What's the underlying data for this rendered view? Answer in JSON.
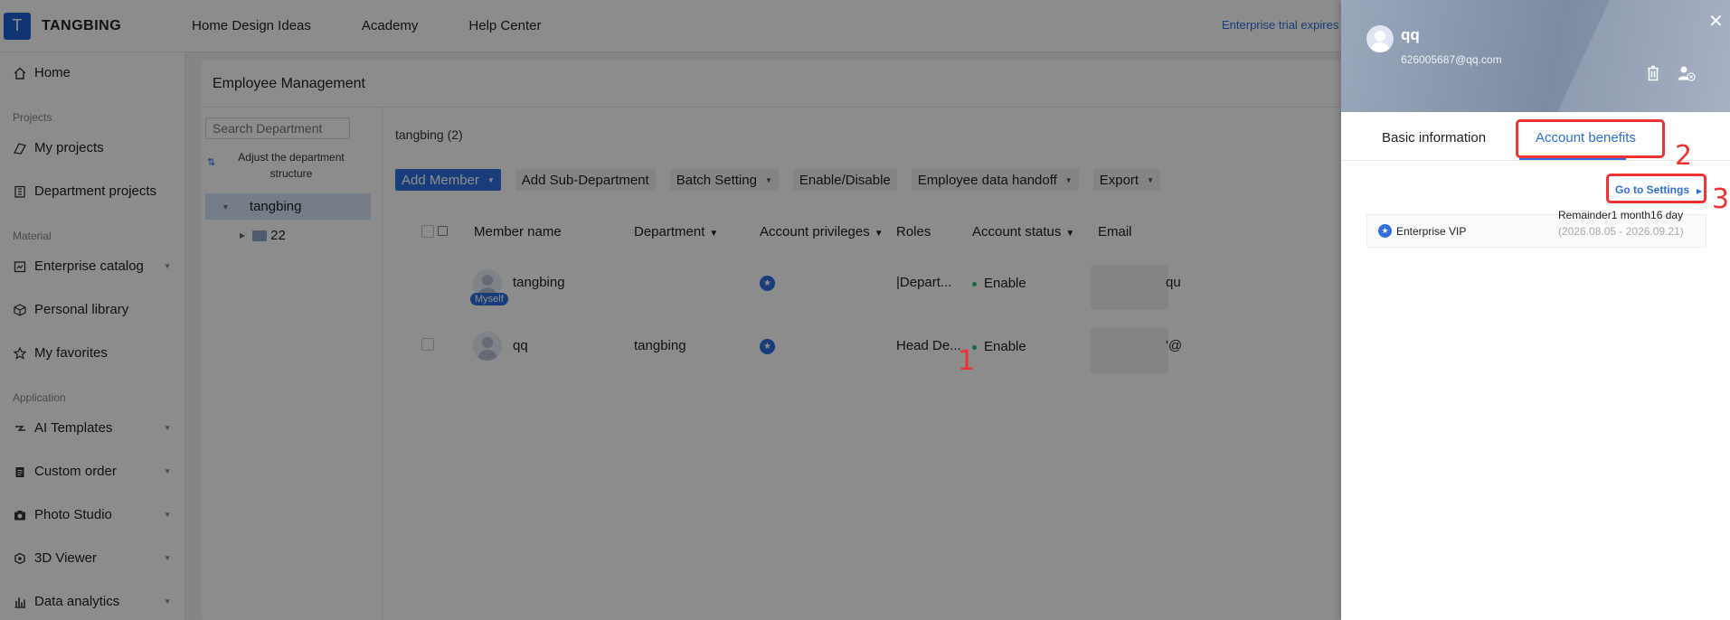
{
  "app": {
    "logo_letter": "T",
    "brand": "TANGBING"
  },
  "topnav": [
    "Home Design Ideas",
    "Academy",
    "Help Center"
  ],
  "trial_text": "Enterprise trial expires i",
  "sidebar": {
    "home": "Home",
    "sec_projects": "Projects",
    "my_projects": "My projects",
    "dept_projects": "Department projects",
    "sec_material": "Material",
    "enterprise_catalog": "Enterprise catalog",
    "personal_library": "Personal library",
    "my_favorites": "My favorites",
    "sec_application": "Application",
    "ai_templates": "AI Templates",
    "custom_order": "Custom order",
    "photo_studio": "Photo Studio",
    "viewer_3d": "3D Viewer",
    "data_analytics": "Data analytics"
  },
  "page": {
    "title": "Employee Management",
    "search_placeholder": "Search Department",
    "adjust_structure": "Adjust the department structure",
    "tree_root": "tangbing",
    "tree_child": "22",
    "member_count": "tangbing (2)"
  },
  "toolbar": {
    "add_member": "Add Member",
    "add_sub_dept": "Add Sub-Department",
    "batch_setting": "Batch Setting",
    "enable_disable": "Enable/Disable",
    "data_handoff": "Employee data handoff",
    "export": "Export"
  },
  "table": {
    "headers": {
      "member_name": "Member name",
      "department": "Department",
      "account_privileges": "Account privileges",
      "roles": "Roles",
      "account_status": "Account status",
      "email": "Email"
    },
    "rows": [
      {
        "name": "tangbing",
        "badge": "Myself",
        "department": "",
        "roles": "|Depart...",
        "status": "Enable",
        "email_partial": "qu"
      },
      {
        "name": "qq",
        "badge": "",
        "department": "tangbing",
        "roles": "Head De...",
        "status": "Enable",
        "email_partial": "'@"
      }
    ]
  },
  "drawer": {
    "name": "qq",
    "email": "626005687@qq.com",
    "tabs": [
      "Basic information",
      "Account benefits"
    ],
    "active_tab": 1,
    "go_to_settings": "Go to Settings",
    "benefit_name": "Enterprise VIP",
    "remainder": "Remainder1 month16 day",
    "date_range": "(2026.08.05 - 2026.09.21)"
  },
  "annotations": [
    "1",
    "2",
    "3"
  ],
  "colors": {
    "accent": "#2f6fe0",
    "annotation": "#ee3333",
    "enable": "#2cc26f"
  }
}
